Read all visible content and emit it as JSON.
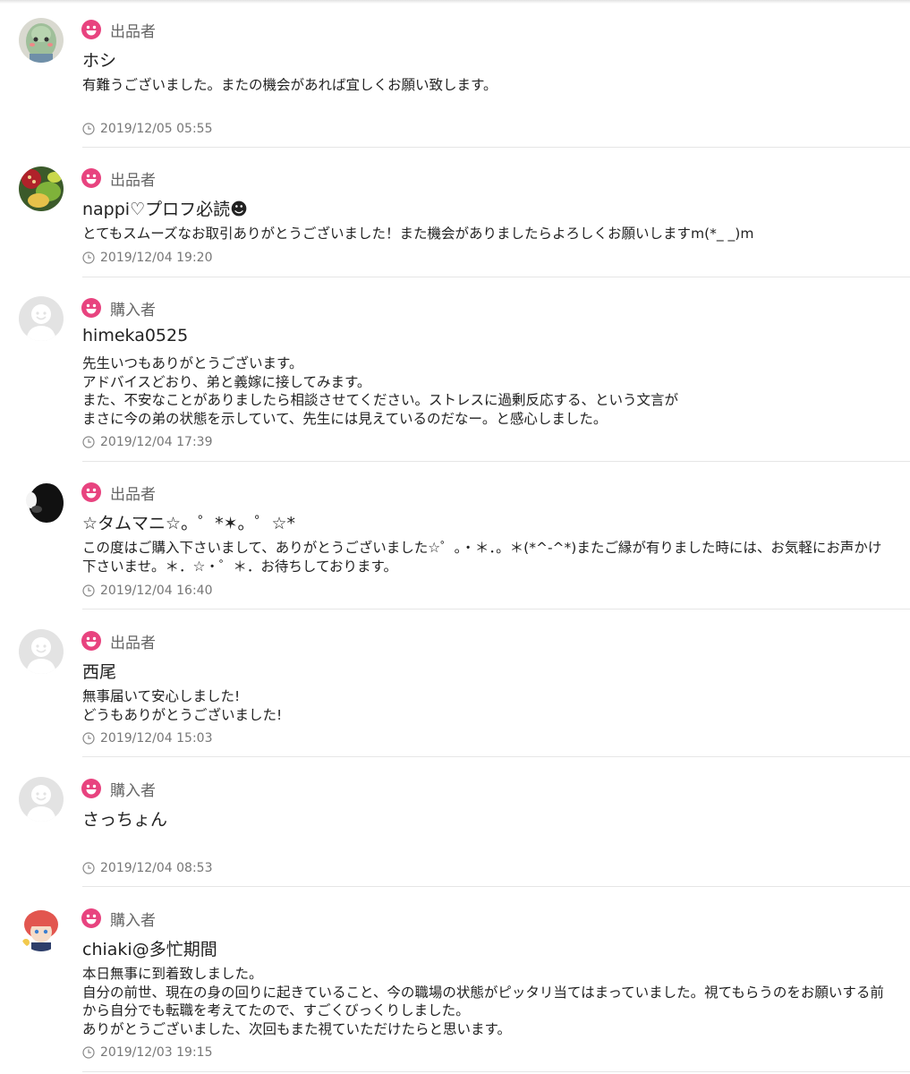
{
  "colors": {
    "role_icon": "#e8437f",
    "divider": "#e6e6e6",
    "default_avatar_bg": "#e3e3e3",
    "default_avatar_fg": "#ffffff"
  },
  "reviews": [
    {
      "role": "出品者",
      "name": "ホシ",
      "comment": "有難うございました。またの機会があれば宜しくお願い致します。",
      "date": "2019/12/05 05:55",
      "avatar": "photo-avatar-green-figure"
    },
    {
      "role": "出品者",
      "name": "nappi♡プロフ必読☻",
      "comment": "とてもスムーズなお取引ありがとうございました！また機会がありましたらよろしくお願いしますm(*_ _)m",
      "date": "2019/12/04 19:20",
      "avatar": "photo-avatar-dessert"
    },
    {
      "role": "購入者",
      "name": "himeka0525",
      "comment": "先生いつもありがとうございます。\nアドバイスどおり、弟と義嫁に接してみます。\nまた、不安なことがありましたら相談させてください。ストレスに過剰反応する、という文言が\nまさに今の弟の状態を示していて、先生には見えているのだなー。と感心しました。",
      "date": "2019/12/04 17:39",
      "avatar": "default-avatar"
    },
    {
      "role": "出品者",
      "name": "☆タムマニ☆。゜*✶。゜☆*",
      "comment": "この度はご購入下さいまして、ありがとうございました☆゜。・＊．。＊(*^-^*)またご縁が有りました時には、お気軽にお声かけ下さいませ。＊．☆・゜＊．お待ちしております。",
      "date": "2019/12/04 16:40",
      "avatar": "photo-avatar-dark"
    },
    {
      "role": "出品者",
      "name": "西尾",
      "comment": "無事届いて安心しました!\nどうもありがとうございました!",
      "date": "2019/12/04 15:03",
      "avatar": "default-avatar"
    },
    {
      "role": "購入者",
      "name": "さっちょん",
      "comment": "",
      "date": "2019/12/04 08:53",
      "avatar": "default-avatar"
    },
    {
      "role": "購入者",
      "name": "chiaki@多忙期間",
      "comment": "本日無事に到着致しました。\n自分の前世、現在の身の回りに起きていること、今の職場の状態がピッタリ当てはまっていました。視てもらうのをお願いする前から自分でも転職を考えてたので、すごくびっくりしました。\nありがとうございました、次回もまた視ていただけたらと思います。",
      "date": "2019/12/03 19:15",
      "avatar": "photo-avatar-anime-character"
    }
  ]
}
